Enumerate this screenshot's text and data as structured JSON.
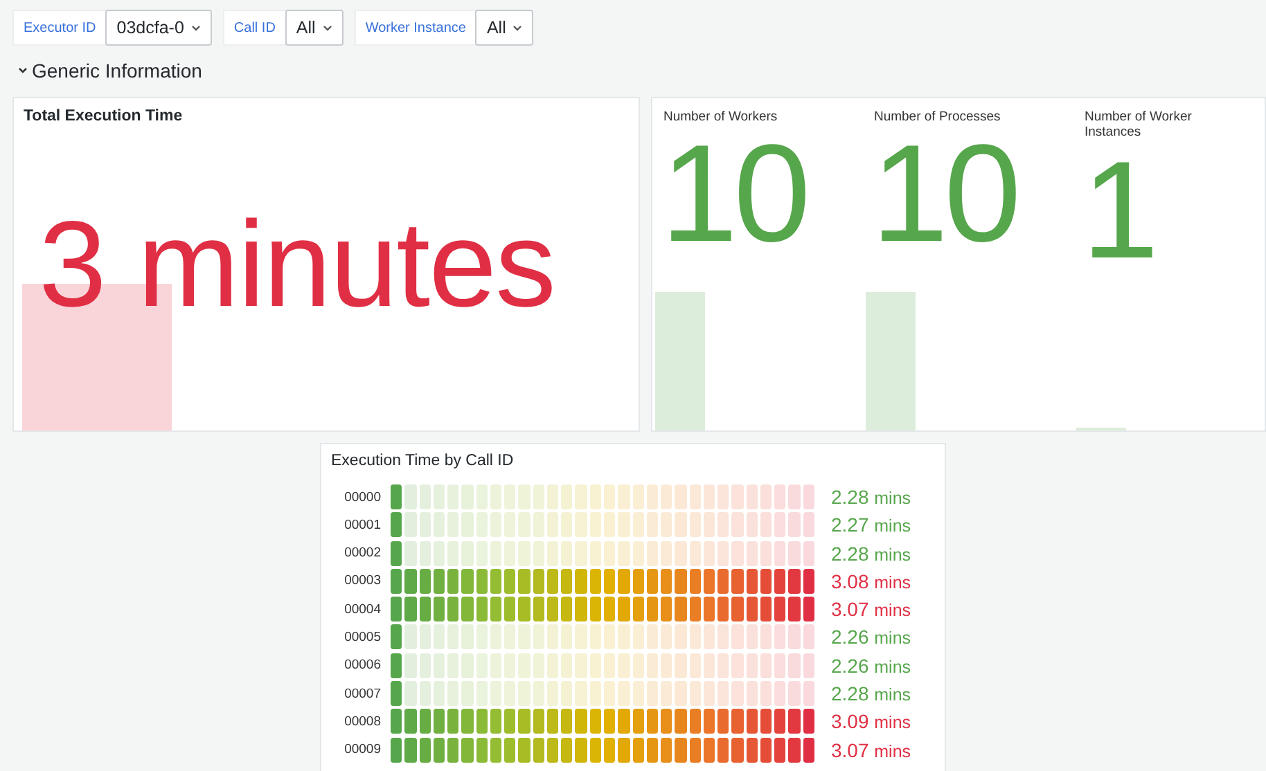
{
  "variables": [
    {
      "label": "Executor ID",
      "value": "03dcfa-0"
    },
    {
      "label": "Call ID",
      "value": "All"
    },
    {
      "label": "Worker Instance",
      "value": "All"
    }
  ],
  "section": {
    "title": "Generic Information",
    "expanded": true
  },
  "total_time": {
    "title": "Total Execution Time",
    "value": "3 minutes",
    "color": "#e02f44"
  },
  "stats": [
    {
      "title": "Number of Workers",
      "value": "10",
      "color": "#56a64b"
    },
    {
      "title": "Number of Processes",
      "value": "10",
      "color": "#56a64b"
    },
    {
      "title": "Number of Worker Instances",
      "value": "1",
      "color": "#56a64b"
    }
  ],
  "bar_gauge": {
    "title": "Execution Time by Call ID",
    "rows": [
      {
        "label": "00000",
        "level": 0.034,
        "value": "2.28",
        "unit": "mins",
        "color": "#56a64b"
      },
      {
        "label": "00001",
        "level": 0.033,
        "value": "2.27",
        "unit": "mins",
        "color": "#56a64b"
      },
      {
        "label": "00002",
        "level": 0.034,
        "value": "2.28",
        "unit": "mins",
        "color": "#56a64b"
      },
      {
        "label": "00003",
        "level": 1,
        "value": "3.08",
        "unit": "mins",
        "color": "#e02f44"
      },
      {
        "label": "00004",
        "level": 1,
        "value": "3.07",
        "unit": "mins",
        "color": "#e02f44"
      },
      {
        "label": "00005",
        "level": 0.033,
        "value": "2.26",
        "unit": "mins",
        "color": "#56a64b"
      },
      {
        "label": "00006",
        "level": 0.033,
        "value": "2.26",
        "unit": "mins",
        "color": "#56a64b"
      },
      {
        "label": "00007",
        "level": 0.034,
        "value": "2.28",
        "unit": "mins",
        "color": "#56a64b"
      },
      {
        "label": "00008",
        "level": 1,
        "value": "3.09",
        "unit": "mins",
        "color": "#e02f44"
      },
      {
        "label": "00009",
        "level": 1,
        "value": "3.07",
        "unit": "mins",
        "color": "#e02f44"
      }
    ]
  }
}
